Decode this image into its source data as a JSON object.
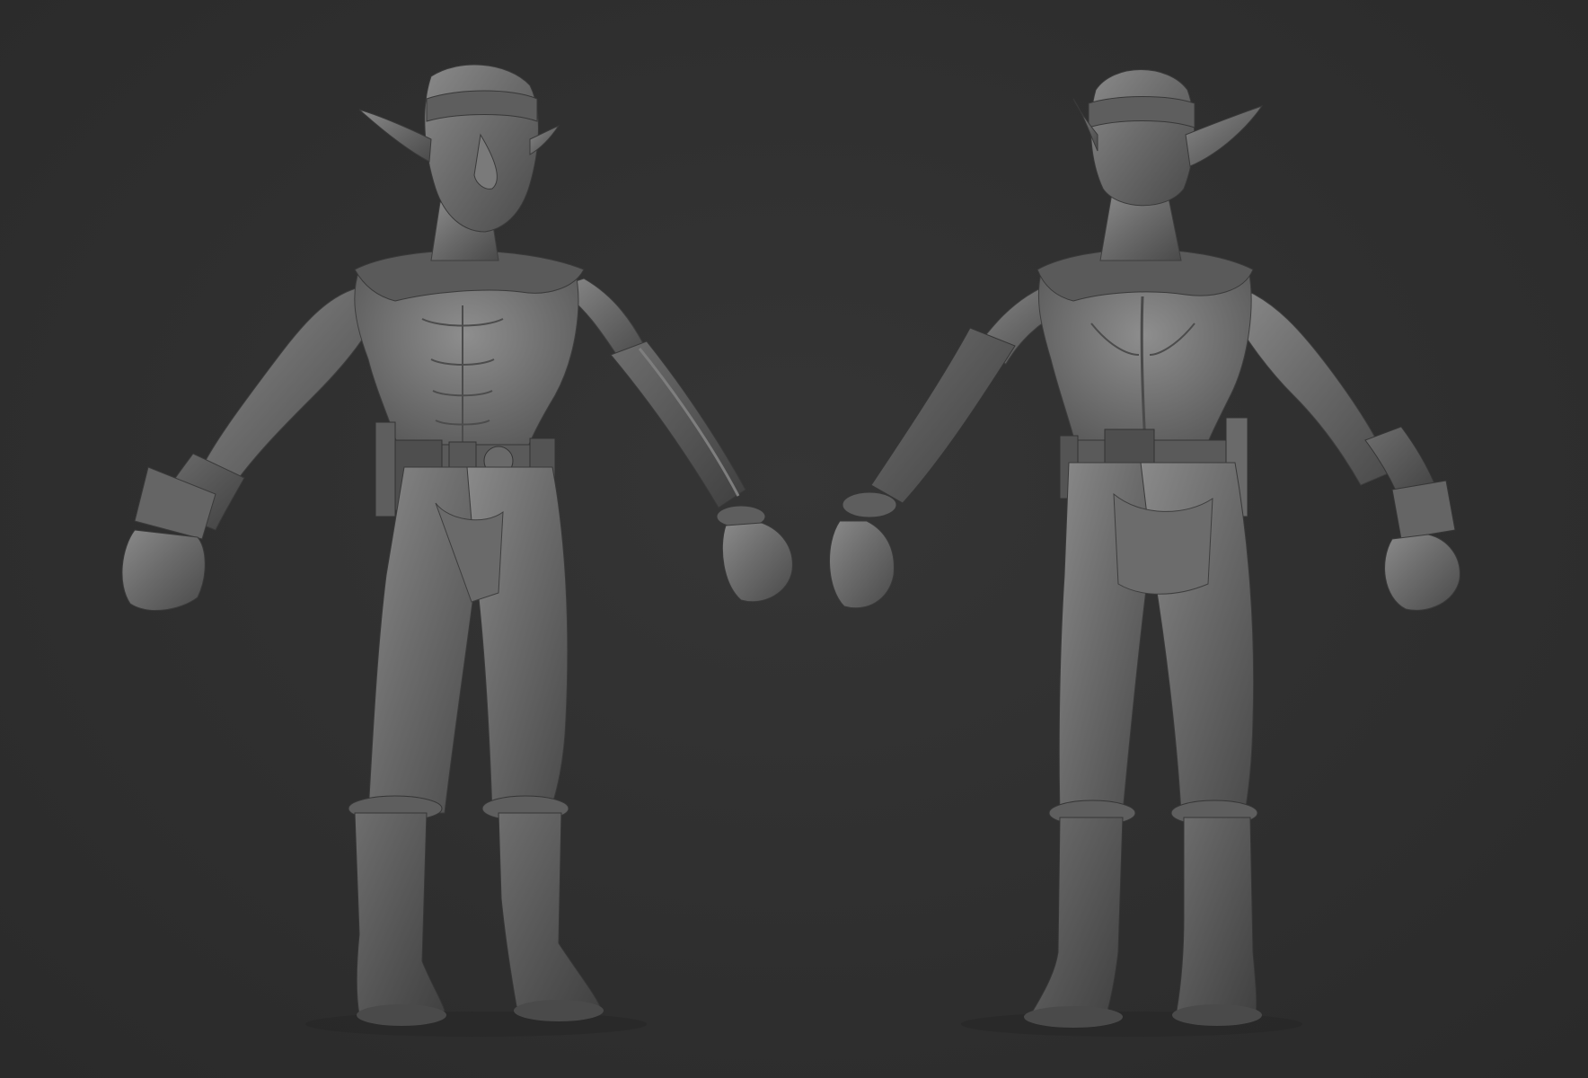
{
  "scene": {
    "background_color": "#2f2f2f",
    "clay_color": "#6e6e6e",
    "clay_shadow_color": "#474747",
    "clay_highlight_color": "#8e8e8e",
    "views": [
      {
        "id": "front",
        "icon": "goblin-front-view-figure"
      },
      {
        "id": "back",
        "icon": "goblin-back-view-figure"
      }
    ]
  }
}
